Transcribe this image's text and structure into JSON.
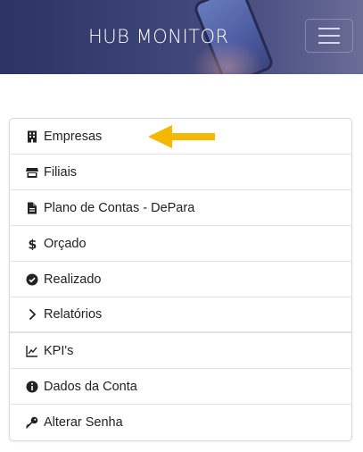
{
  "header": {
    "title": "HUB MONITOR"
  },
  "menu": {
    "items": [
      {
        "label": "Empresas",
        "icon": "building-icon"
      },
      {
        "label": "Filiais",
        "icon": "store-icon"
      },
      {
        "label": "Plano de Contas - DePara",
        "icon": "file-icon"
      },
      {
        "label": "Orçado",
        "icon": "dollar-icon"
      },
      {
        "label": "Realizado",
        "icon": "check-circle-icon"
      },
      {
        "label": "Relatórios",
        "icon": "chevron-right-icon"
      },
      {
        "label": "KPI's",
        "icon": "chart-line-icon"
      },
      {
        "label": "Dados da Conta",
        "icon": "info-circle-icon"
      },
      {
        "label": "Alterar Senha",
        "icon": "key-icon"
      }
    ]
  },
  "colors": {
    "header_bg": "#2d3463",
    "arrow": "#f5b800"
  }
}
